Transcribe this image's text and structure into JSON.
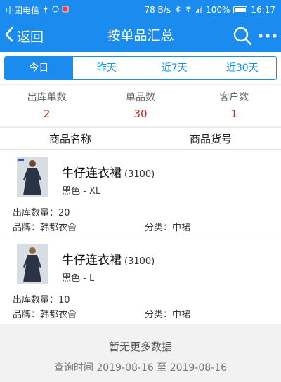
{
  "status_bar": {
    "carrier": "中国电信",
    "speed": "78 B/s",
    "battery": "100%",
    "time": "16:17"
  },
  "nav": {
    "back_label": "返回",
    "title": "按单品汇总"
  },
  "tabs": [
    {
      "label": "今日",
      "active": true
    },
    {
      "label": "昨天",
      "active": false
    },
    {
      "label": "近7天",
      "active": false
    },
    {
      "label": "近30天",
      "active": false
    }
  ],
  "stats": [
    {
      "label": "出库单数",
      "value": "2"
    },
    {
      "label": "单品数",
      "value": "30"
    },
    {
      "label": "客户数",
      "value": "1"
    }
  ],
  "columns": {
    "name": "商品名称",
    "code": "商品货号"
  },
  "products": [
    {
      "name": "牛仔连衣裙",
      "code": "(3100)",
      "spec": "黑色 - XL",
      "qty": "出库数量：20",
      "brand": "品牌：韩都衣舍",
      "category": "分类：中裙"
    },
    {
      "name": "牛仔连衣裙",
      "code": "(3100)",
      "spec": "黑色 - L",
      "qty": "出库数量：10",
      "brand": "品牌：韩都衣舍",
      "category": "分类：中裙"
    }
  ],
  "footer": {
    "no_more": "暂无更多数据",
    "query_range": "查询时间 2019-08-16 至 2019-08-16"
  },
  "colors": {
    "primary": "#1a8cf0",
    "stat_value": "#e01a1a"
  }
}
